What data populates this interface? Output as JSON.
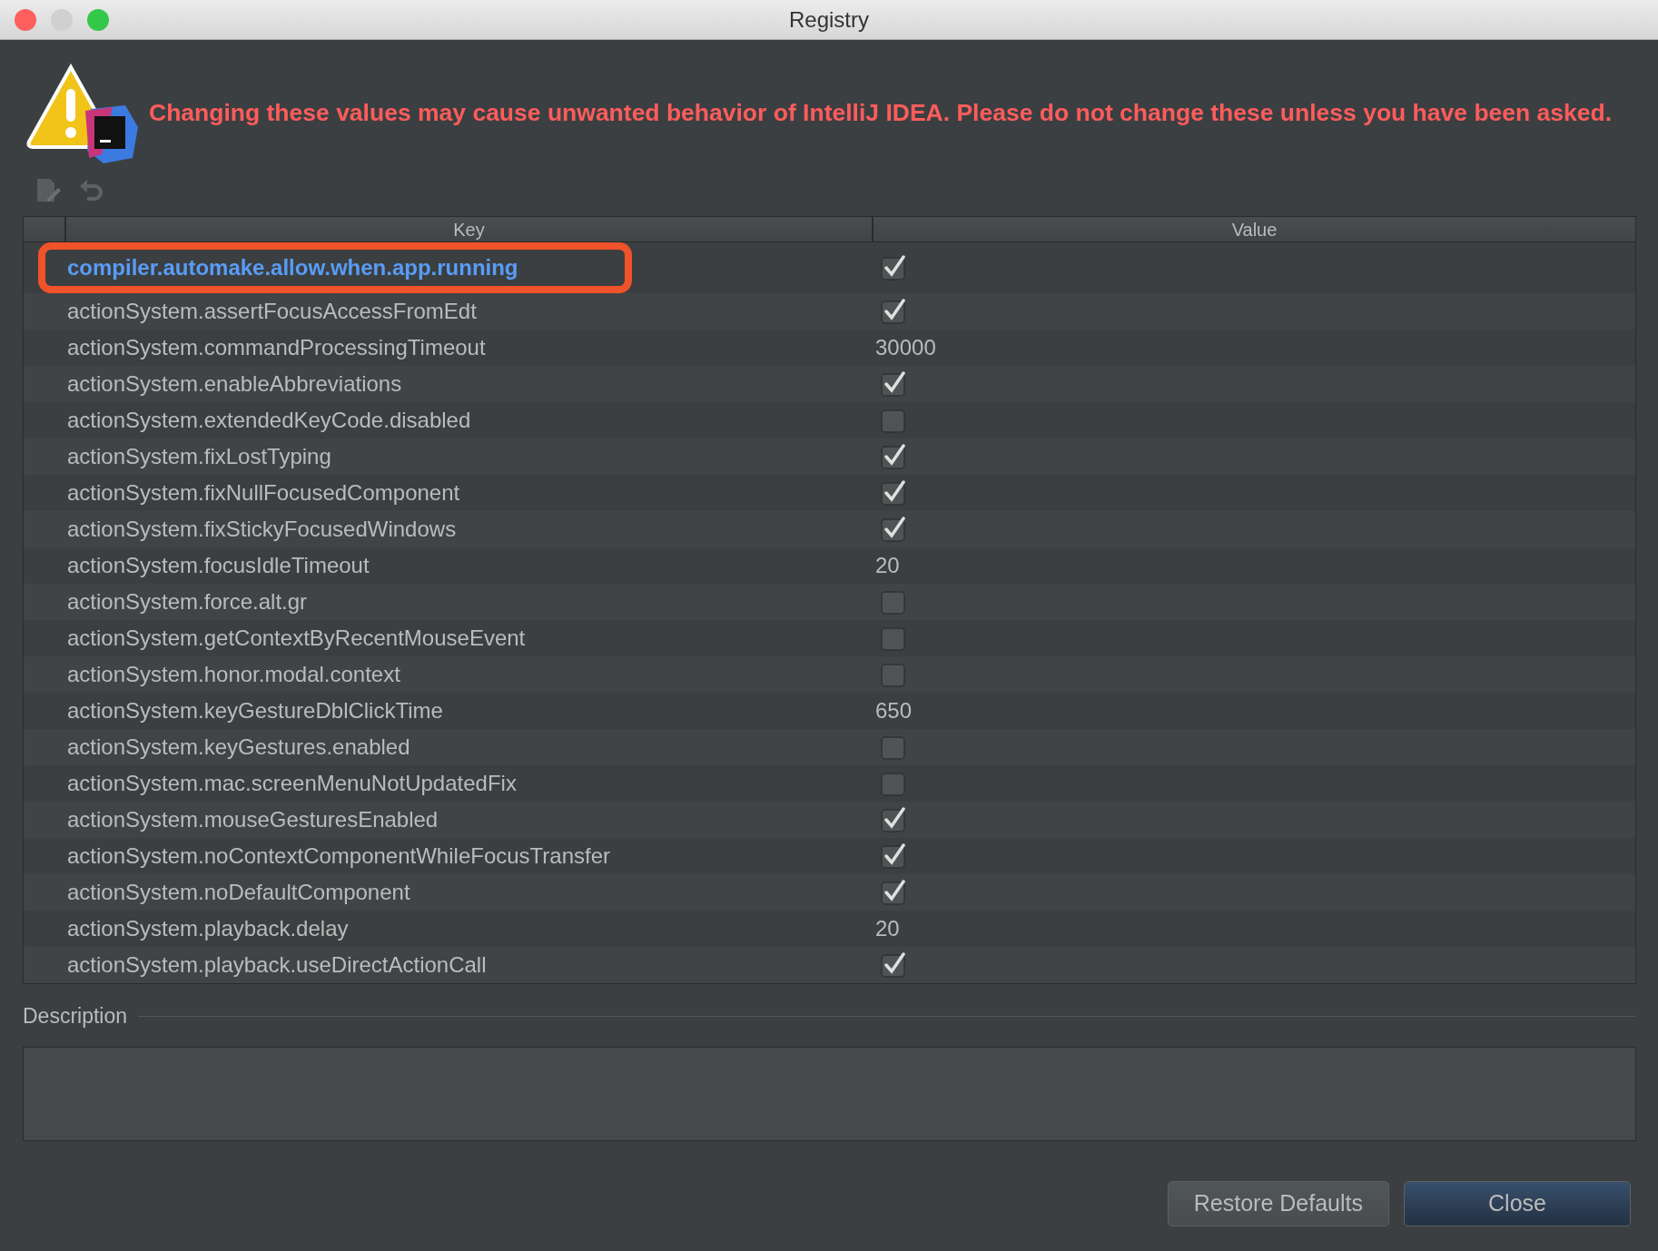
{
  "window": {
    "title": "Registry"
  },
  "warning": "Changing these values may cause unwanted behavior of IntelliJ IDEA. Please do not change these unless you have been asked.",
  "table": {
    "columns": [
      "Key",
      "Value"
    ],
    "rows": [
      {
        "key": "compiler.automake.allow.when.app.running",
        "kind": "checkbox",
        "checked": true,
        "selected": true,
        "outlined": true
      },
      {
        "key": "actionSystem.assertFocusAccessFromEdt",
        "kind": "checkbox",
        "checked": true,
        "selected": false,
        "outlined": false
      },
      {
        "key": "actionSystem.commandProcessingTimeout",
        "kind": "text",
        "value": "30000",
        "selected": false,
        "outlined": false
      },
      {
        "key": "actionSystem.enableAbbreviations",
        "kind": "checkbox",
        "checked": true,
        "selected": false,
        "outlined": false
      },
      {
        "key": "actionSystem.extendedKeyCode.disabled",
        "kind": "checkbox",
        "checked": false,
        "selected": false,
        "outlined": false
      },
      {
        "key": "actionSystem.fixLostTyping",
        "kind": "checkbox",
        "checked": true,
        "selected": false,
        "outlined": false
      },
      {
        "key": "actionSystem.fixNullFocusedComponent",
        "kind": "checkbox",
        "checked": true,
        "selected": false,
        "outlined": false
      },
      {
        "key": "actionSystem.fixStickyFocusedWindows",
        "kind": "checkbox",
        "checked": true,
        "selected": false,
        "outlined": false
      },
      {
        "key": "actionSystem.focusIdleTimeout",
        "kind": "text",
        "value": "20",
        "selected": false,
        "outlined": false
      },
      {
        "key": "actionSystem.force.alt.gr",
        "kind": "checkbox",
        "checked": false,
        "selected": false,
        "outlined": false
      },
      {
        "key": "actionSystem.getContextByRecentMouseEvent",
        "kind": "checkbox",
        "checked": false,
        "selected": false,
        "outlined": false
      },
      {
        "key": "actionSystem.honor.modal.context",
        "kind": "checkbox",
        "checked": false,
        "selected": false,
        "outlined": false
      },
      {
        "key": "actionSystem.keyGestureDblClickTime",
        "kind": "text",
        "value": "650",
        "selected": false,
        "outlined": false
      },
      {
        "key": "actionSystem.keyGestures.enabled",
        "kind": "checkbox",
        "checked": false,
        "selected": false,
        "outlined": false
      },
      {
        "key": "actionSystem.mac.screenMenuNotUpdatedFix",
        "kind": "checkbox",
        "checked": false,
        "selected": false,
        "outlined": false
      },
      {
        "key": "actionSystem.mouseGesturesEnabled",
        "kind": "checkbox",
        "checked": true,
        "selected": false,
        "outlined": false
      },
      {
        "key": "actionSystem.noContextComponentWhileFocusTransfer",
        "kind": "checkbox",
        "checked": true,
        "selected": false,
        "outlined": false
      },
      {
        "key": "actionSystem.noDefaultComponent",
        "kind": "checkbox",
        "checked": true,
        "selected": false,
        "outlined": false
      },
      {
        "key": "actionSystem.playback.delay",
        "kind": "text",
        "value": "20",
        "selected": false,
        "outlined": false
      },
      {
        "key": "actionSystem.playback.useDirectActionCall",
        "kind": "checkbox",
        "checked": true,
        "selected": false,
        "outlined": false
      }
    ]
  },
  "description": {
    "label": "Description"
  },
  "buttons": [
    {
      "label": "Restore Defaults",
      "kind": "secondary"
    },
    {
      "label": "Close",
      "kind": "primary"
    }
  ]
}
